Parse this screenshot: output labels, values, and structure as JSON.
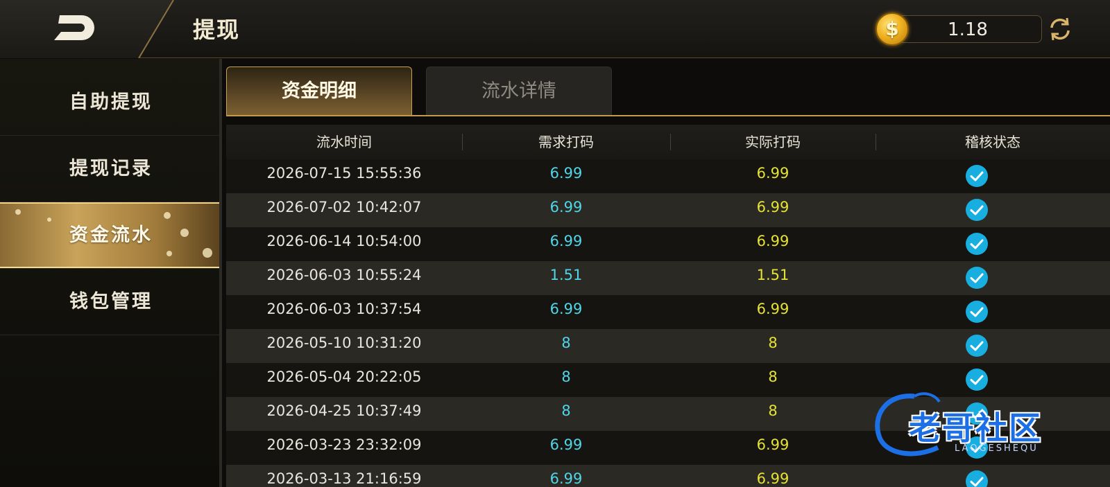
{
  "header": {
    "title": "提现",
    "balance": "1.18",
    "coin_symbol": "$",
    "back_icon": "back-icon",
    "refresh_icon": "refresh-icon"
  },
  "sidebar": {
    "items": [
      {
        "label": "自助提现",
        "active": false
      },
      {
        "label": "提现记录",
        "active": false
      },
      {
        "label": "资金流水",
        "active": true
      },
      {
        "label": "钱包管理",
        "active": false
      }
    ]
  },
  "tabs": [
    {
      "label": "资金明细",
      "active": true
    },
    {
      "label": "流水详情",
      "active": false
    }
  ],
  "table": {
    "columns": [
      "流水时间",
      "需求打码",
      "实际打码",
      "稽核状态"
    ],
    "rows": [
      {
        "time": "2026-07-15 15:55:36",
        "required": "6.99",
        "actual": "6.99",
        "status": "check-icon"
      },
      {
        "time": "2026-07-02 10:42:07",
        "required": "6.99",
        "actual": "6.99",
        "status": "check-icon"
      },
      {
        "time": "2026-06-14 10:54:00",
        "required": "6.99",
        "actual": "6.99",
        "status": "check-icon"
      },
      {
        "time": "2026-06-03 10:55:24",
        "required": "1.51",
        "actual": "1.51",
        "status": "check-icon"
      },
      {
        "time": "2026-06-03 10:37:54",
        "required": "6.99",
        "actual": "6.99",
        "status": "check-icon"
      },
      {
        "time": "2026-05-10 10:31:20",
        "required": "8",
        "actual": "8",
        "status": "check-icon"
      },
      {
        "time": "2026-05-04 20:22:05",
        "required": "8",
        "actual": "8",
        "status": "check-icon"
      },
      {
        "time": "2026-04-25 10:37:49",
        "required": "8",
        "actual": "8",
        "status": "check-icon"
      },
      {
        "time": "2026-03-23 23:32:09",
        "required": "6.99",
        "actual": "6.99",
        "status": "check-icon"
      },
      {
        "time": "2026-03-13 21:16:59",
        "required": "6.99",
        "actual": "6.99",
        "status": "check-icon"
      }
    ]
  },
  "watermark": {
    "text": "老哥社区",
    "sub": "LAOGESHEQU"
  },
  "colors": {
    "required_value": "#4fd6e8",
    "actual_value": "#e6e234",
    "check": "#18aee0",
    "gold_accent": "#c49a4c"
  }
}
